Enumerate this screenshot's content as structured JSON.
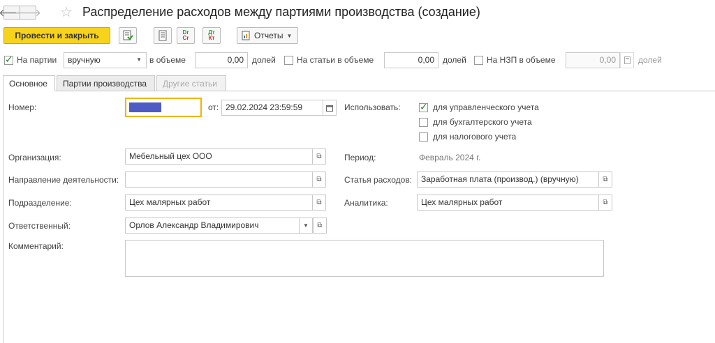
{
  "header": {
    "title": "Распределение расходов между партиями производства (создание)",
    "back_icon": "arrow-left-icon",
    "forward_icon": "arrow-right-icon",
    "favorite_icon": "star-icon"
  },
  "toolbar": {
    "post_close_label": "Провести и закрыть",
    "reports_label": "Отчеты",
    "dr_text": "Dr",
    "cr_text": "Cr",
    "dt_text": "Дт",
    "kt_text": "Кт"
  },
  "top_row": {
    "batches_label": "На партии",
    "batches_checked": true,
    "mode_value": "вручную",
    "volume_label1": "в объеме",
    "volume_value1": "0,00",
    "shares_label1": "долей",
    "items_label": "На статьи в объеме",
    "items_checked": false,
    "volume_value2": "0,00",
    "shares_label2": "долей",
    "wip_label": "На НЗП в объеме",
    "wip_checked": false,
    "volume_value3": "0,00",
    "shares_label3": "долей"
  },
  "tabs": [
    {
      "label": "Основное",
      "state": "active"
    },
    {
      "label": "Партии производства",
      "state": "normal"
    },
    {
      "label": "Другие статьи",
      "state": "disabled"
    }
  ],
  "form": {
    "number_label": "Номер:",
    "from_label": "от:",
    "date_value": "29.02.2024 23:59:59",
    "use_label": "Использовать:",
    "use_options": [
      {
        "label": "для управленческого учета",
        "checked": true
      },
      {
        "label": "для бухгалтерского учета",
        "checked": false
      },
      {
        "label": "для налогового учета",
        "checked": false
      }
    ],
    "org_label": "Организация:",
    "org_value": "Мебельный цех ООО",
    "period_label": "Период:",
    "period_value": "Февраль 2024 г.",
    "direction_label": "Направление деятельности:",
    "direction_value": "",
    "expense_label": "Статья расходов:",
    "expense_value": "Заработная плата (производ.) (вручную)",
    "dept_label": "Подразделение:",
    "dept_value": "Цех малярных работ",
    "analytics_label": "Аналитика:",
    "analytics_value": "Цех малярных работ",
    "resp_label": "Ответственный:",
    "resp_value": "Орлов Александр Владимирович",
    "comment_label": "Комментарий:",
    "comment_value": ""
  },
  "colors": {
    "primary_button": "#f7d31c",
    "number_fill": "#4f5bc4",
    "focus_border": "#f0b400",
    "check_green": "#1b8b1b"
  }
}
